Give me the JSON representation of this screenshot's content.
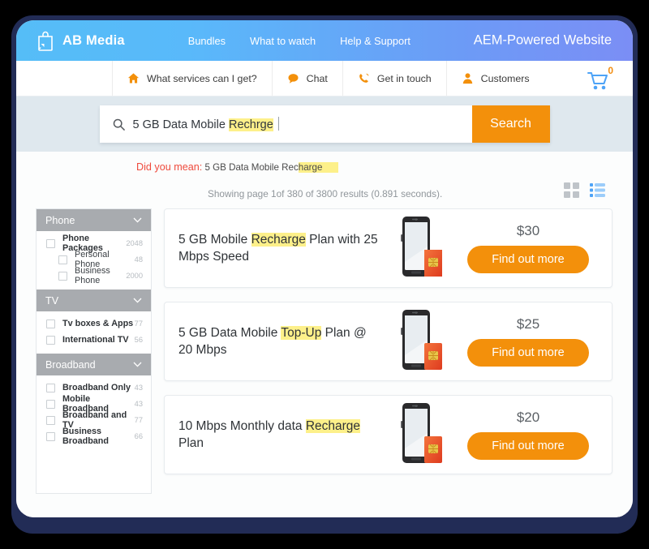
{
  "header": {
    "brand": "AB Media",
    "brand_icon": "shopping-bag-icon",
    "nav": [
      {
        "label": "Bundles"
      },
      {
        "label": "What to watch"
      },
      {
        "label": "Help & Support"
      }
    ],
    "site_title": "AEM-Powered Website",
    "gradient_from": "#55bdf7",
    "gradient_to": "#7b8ef5"
  },
  "subnav": {
    "items": [
      {
        "label": "What services can I get?",
        "icon": "home-icon"
      },
      {
        "label": "Chat",
        "icon": "chat-bubble-icon"
      },
      {
        "label": "Get in touch",
        "icon": "phone-icon"
      },
      {
        "label": "Customers",
        "icon": "user-icon"
      }
    ],
    "cart": {
      "icon": "shopping-cart-icon",
      "count": "0",
      "badge_color": "#f28c0f"
    }
  },
  "search": {
    "icon": "search-icon",
    "value_prefix": "5 GB Data Mobile ",
    "value_highlight": "Rechrge",
    "button_label": "Search",
    "button_color": "#f3900b",
    "highlight_color": "#fdf08a"
  },
  "suggestion": {
    "label": "Did you mean:",
    "label_color": "#ef4a3c",
    "text_prefix": "5 GB Data Mobile Rec",
    "text_highlight": "harge"
  },
  "results_info": "Showing page 1of 380 of 3800 results (0.891 seconds).",
  "view_toggle": {
    "grid": {
      "icon": "grid-view-icon",
      "active": false,
      "color": "#bfc4c9"
    },
    "list": {
      "icon": "list-view-icon",
      "active": true,
      "color": "#4da3f7"
    }
  },
  "sidebar": {
    "facets": [
      {
        "title": "Phone",
        "chevron": "chevron-down-icon",
        "rows": [
          {
            "label": "Phone Packages",
            "count": "2048",
            "indent": false
          },
          {
            "label": "Personal Phone",
            "count": "48",
            "indent": true
          },
          {
            "label": "Business Phone",
            "count": "2000",
            "indent": true
          }
        ]
      },
      {
        "title": "TV",
        "chevron": "chevron-down-icon",
        "rows": [
          {
            "label": "Tv boxes & Apps",
            "count": "77",
            "indent": false
          },
          {
            "label": "International TV",
            "count": "56",
            "indent": false
          }
        ]
      },
      {
        "title": "Broadband",
        "chevron": "chevron-down-icon",
        "rows": [
          {
            "label": "Broadband Only",
            "count": "43",
            "indent": false
          },
          {
            "label": "Mobile Broadband",
            "count": "43",
            "indent": false
          },
          {
            "label": "Broadband and TV",
            "count": "77",
            "indent": false
          },
          {
            "label": "Business Broadband",
            "count": "66",
            "indent": false
          }
        ]
      }
    ]
  },
  "results": [
    {
      "title_parts": [
        {
          "text": "5 GB Mobile ",
          "highlight": false
        },
        {
          "text": "Recharge",
          "highlight": true
        },
        {
          "text": " Plan with 25 Mbps Speed",
          "highlight": false
        }
      ],
      "price": "$30",
      "cta": "Find out more",
      "image": "smartphone-with-sim-card"
    },
    {
      "title_parts": [
        {
          "text": "5 GB Data Mobile ",
          "highlight": false
        },
        {
          "text": "Top-Up",
          "highlight": true
        },
        {
          "text": " Plan @ 20 Mbps",
          "highlight": false
        }
      ],
      "price": "$25",
      "cta": "Find out more",
      "image": "smartphone-with-sim-card"
    },
    {
      "title_parts": [
        {
          "text": "10 Mbps Monthly data ",
          "highlight": false
        },
        {
          "text": "Recharge",
          "highlight": true
        },
        {
          "text": " Plan",
          "highlight": false
        }
      ],
      "price": "$20",
      "cta": "Find out more",
      "image": "smartphone-with-sim-card"
    }
  ]
}
